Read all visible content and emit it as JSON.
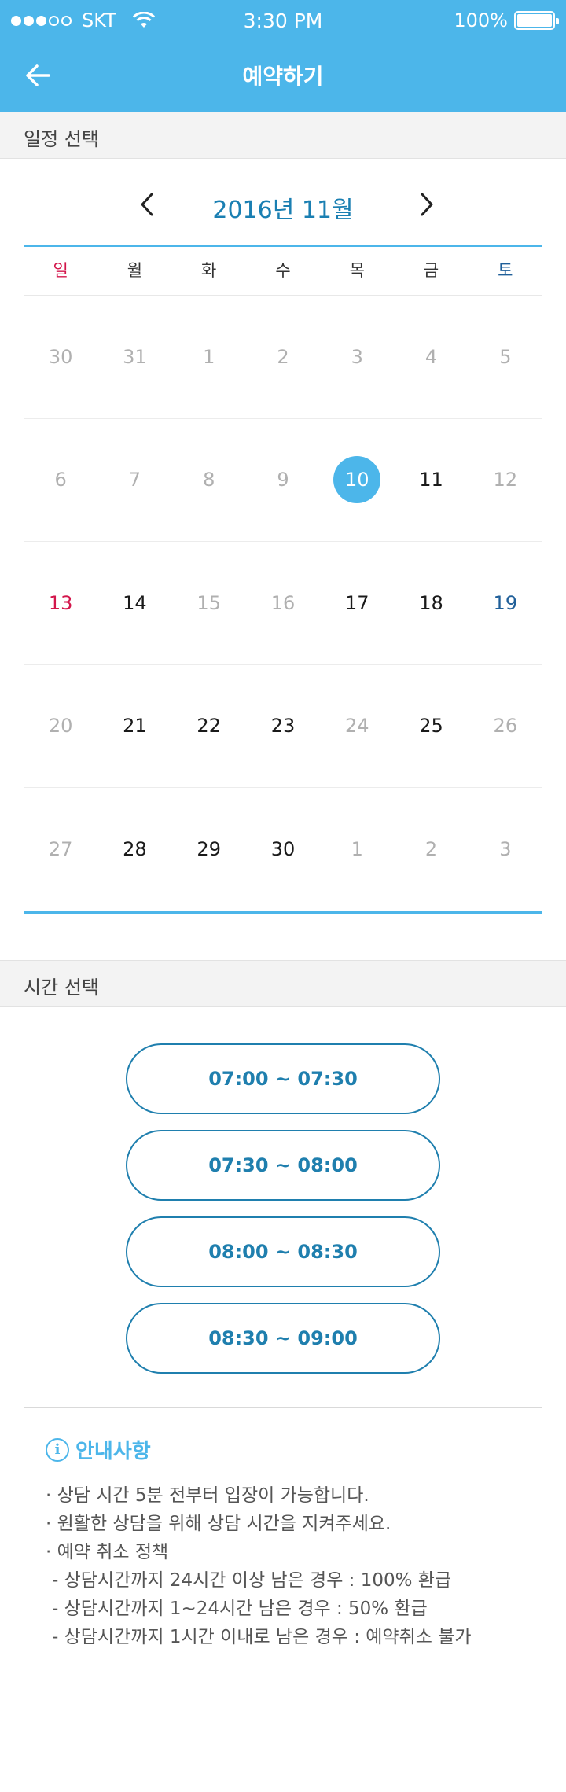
{
  "status_bar": {
    "carrier": "SKT",
    "time": "3:30 PM",
    "battery": "100%"
  },
  "header": {
    "title": "예약하기",
    "back_icon": "arrow-left-icon"
  },
  "schedule_section": {
    "label": "일정 선택"
  },
  "calendar": {
    "month_label": "2016년 11월",
    "weekdays": [
      "일",
      "월",
      "화",
      "수",
      "목",
      "금",
      "토"
    ],
    "weeks": [
      [
        {
          "d": "30",
          "t": "muted"
        },
        {
          "d": "31",
          "t": "muted"
        },
        {
          "d": "1",
          "t": "muted"
        },
        {
          "d": "2",
          "t": "muted"
        },
        {
          "d": "3",
          "t": "muted"
        },
        {
          "d": "4",
          "t": "muted"
        },
        {
          "d": "5",
          "t": "muted"
        }
      ],
      [
        {
          "d": "6",
          "t": "muted"
        },
        {
          "d": "7",
          "t": "muted"
        },
        {
          "d": "8",
          "t": "muted"
        },
        {
          "d": "9",
          "t": "muted"
        },
        {
          "d": "10",
          "t": "selected"
        },
        {
          "d": "11",
          "t": "normal"
        },
        {
          "d": "12",
          "t": "muted"
        }
      ],
      [
        {
          "d": "13",
          "t": "sun"
        },
        {
          "d": "14",
          "t": "normal"
        },
        {
          "d": "15",
          "t": "muted"
        },
        {
          "d": "16",
          "t": "muted"
        },
        {
          "d": "17",
          "t": "normal"
        },
        {
          "d": "18",
          "t": "normal"
        },
        {
          "d": "19",
          "t": "sat"
        }
      ],
      [
        {
          "d": "20",
          "t": "muted"
        },
        {
          "d": "21",
          "t": "normal"
        },
        {
          "d": "22",
          "t": "normal"
        },
        {
          "d": "23",
          "t": "normal"
        },
        {
          "d": "24",
          "t": "muted"
        },
        {
          "d": "25",
          "t": "normal"
        },
        {
          "d": "26",
          "t": "muted"
        }
      ],
      [
        {
          "d": "27",
          "t": "muted"
        },
        {
          "d": "28",
          "t": "normal"
        },
        {
          "d": "29",
          "t": "normal"
        },
        {
          "d": "30",
          "t": "normal"
        },
        {
          "d": "1",
          "t": "muted"
        },
        {
          "d": "2",
          "t": "muted"
        },
        {
          "d": "3",
          "t": "muted"
        }
      ]
    ]
  },
  "time_section": {
    "label": "시간 선택"
  },
  "time_slots": [
    "07:00 ~ 07:30",
    "07:30 ~ 08:00",
    "08:00 ~ 08:30",
    "08:30 ~ 09:00"
  ],
  "notice": {
    "title": "안내사항",
    "lines": [
      "· 상담 시간 5분 전부터 입장이 가능합니다.",
      "· 원활한 상담을 위해 상담 시간을 지켜주세요.",
      "· 예약 취소 정책",
      "- 상담시간까지 24시간 이상 남은 경우 : 100% 환급",
      "- 상담시간까지 1~24시간 남은 경우 : 50% 환급",
      "- 상담시간까지 1시간 이내로 남은 경우 : 예약취소 불가"
    ]
  },
  "colors": {
    "accent": "#4cb6ea",
    "slot_border": "#1f7fae",
    "sunday": "#d3164b",
    "saturday": "#1f5f99"
  }
}
